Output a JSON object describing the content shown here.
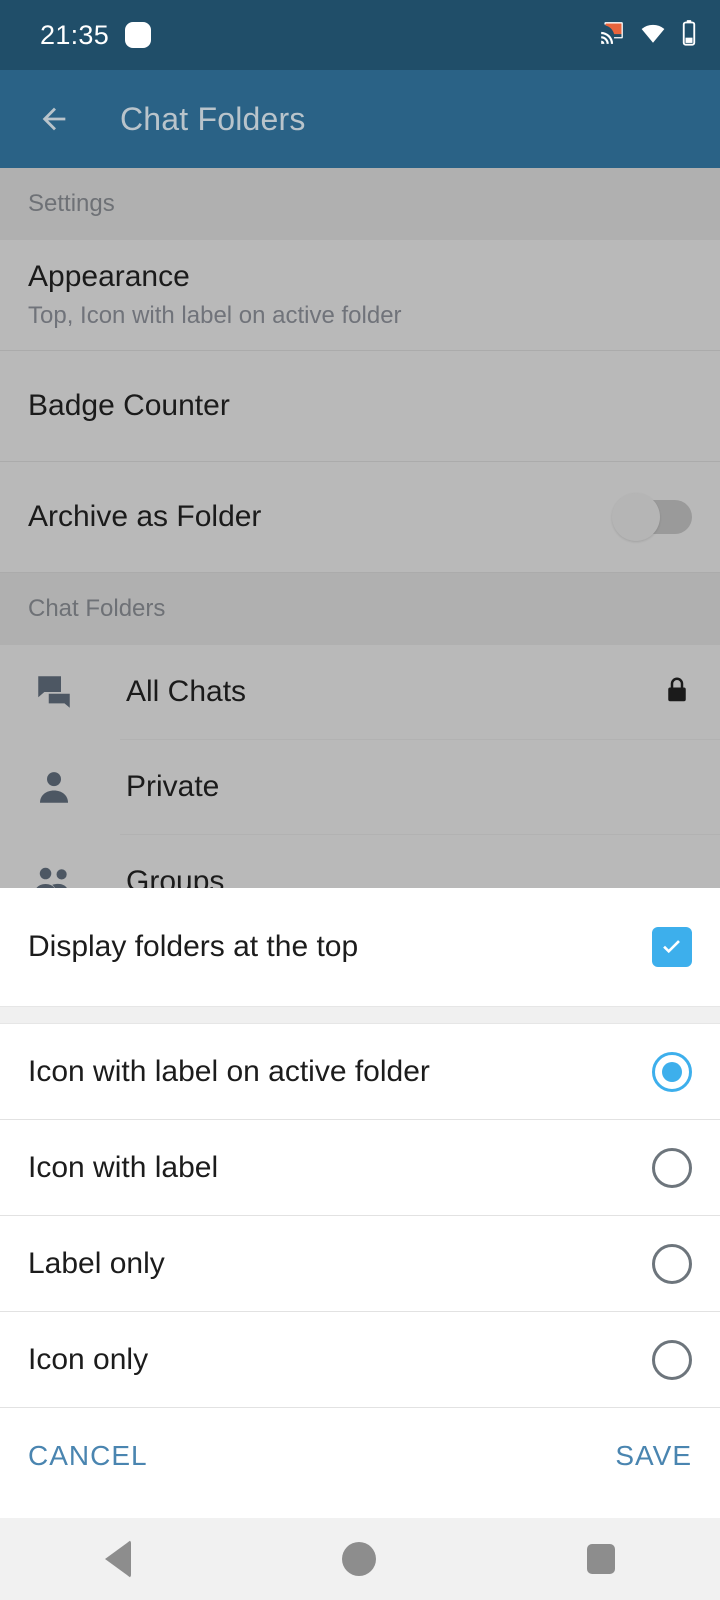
{
  "status_bar": {
    "time": "21:35",
    "notification_icon": "notification-dot-icon",
    "cast_icon": "cast-icon",
    "wifi_icon": "wifi-icon",
    "battery_icon": "battery-icon",
    "background_color": "#204e69",
    "cast_color": "#e8643c"
  },
  "app_bar": {
    "back_icon": "back-arrow-icon",
    "title": "Chat Folders",
    "background_color": "#2a6286",
    "title_color": "#b9c4cb"
  },
  "background_screen": {
    "sections": [
      {
        "header": "Settings",
        "rows": [
          {
            "title": "Appearance",
            "subtitle": "Top, Icon with label on active folder",
            "control": "none"
          },
          {
            "title": "Badge Counter",
            "subtitle": "",
            "control": "none"
          },
          {
            "title": "Archive as Folder",
            "subtitle": "",
            "control": "switch",
            "switch_on": false
          }
        ]
      },
      {
        "header": "Chat Folders",
        "folders": [
          {
            "label": "All Chats",
            "icon": "chat-bubbles-icon",
            "trailing_icon": "lock-icon"
          },
          {
            "label": "Private",
            "icon": "person-icon",
            "trailing_icon": ""
          },
          {
            "label": "Groups",
            "icon": "people-icon",
            "trailing_icon": ""
          }
        ]
      }
    ]
  },
  "dialog": {
    "checkbox_option": {
      "label": "Display folders at the top",
      "checked": true
    },
    "radio_options": [
      {
        "label": "Icon with label on active folder",
        "selected": true
      },
      {
        "label": "Icon with label",
        "selected": false
      },
      {
        "label": "Label only",
        "selected": false
      },
      {
        "label": "Icon only",
        "selected": false
      }
    ],
    "cancel_label": "CANCEL",
    "save_label": "SAVE",
    "accent_color": "#3dafec",
    "button_color": "#4a85b0"
  },
  "nav_bar": {
    "back_icon": "nav-back-icon",
    "home_icon": "nav-home-icon",
    "recents_icon": "nav-recents-icon",
    "background_color": "#f1f1f1"
  }
}
